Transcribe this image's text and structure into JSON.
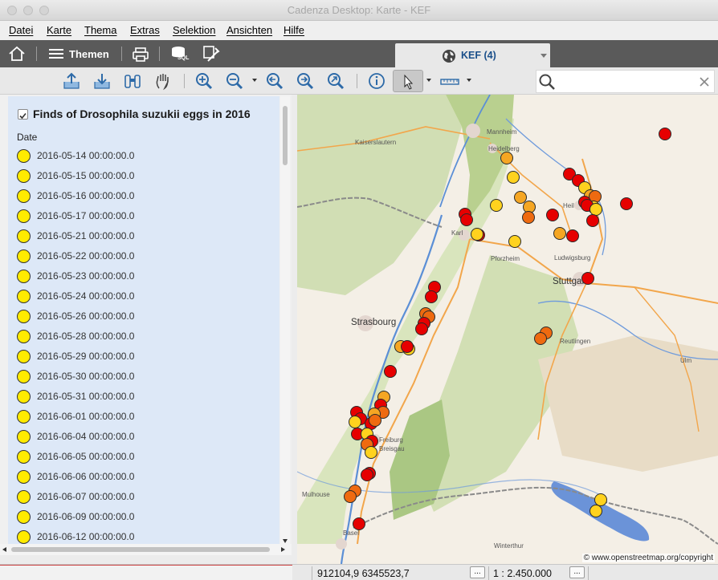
{
  "window": {
    "title": "Cadenza Desktop: Karte - KEF"
  },
  "menu": [
    {
      "label": "Datei"
    },
    {
      "label": "Karte"
    },
    {
      "label": "Thema"
    },
    {
      "label": "Extras"
    },
    {
      "label": "Selektion"
    },
    {
      "label": "Ansichten"
    },
    {
      "label": "Hilfe"
    }
  ],
  "darkbar": {
    "themes_label": "Themen",
    "sql_label": "SQL",
    "tab_label": "KEF (4)"
  },
  "search": {
    "placeholder": "",
    "value": ""
  },
  "legend": {
    "layer_title": "Finds of Drosophila suzukii eggs in 2016",
    "layer_checked": true,
    "attribute_label": "Date",
    "symbol_color": "#ffeb00",
    "items": [
      "2016-05-14 00:00:00.0",
      "2016-05-15 00:00:00.0",
      "2016-05-16 00:00:00.0",
      "2016-05-17 00:00:00.0",
      "2016-05-21 00:00:00.0",
      "2016-05-22 00:00:00.0",
      "2016-05-23 00:00:00.0",
      "2016-05-24 00:00:00.0",
      "2016-05-26 00:00:00.0",
      "2016-05-28 00:00:00.0",
      "2016-05-29 00:00:00.0",
      "2016-05-30 00:00:00.0",
      "2016-05-31 00:00:00.0",
      "2016-06-01 00:00:00.0",
      "2016-06-04 00:00:00.0",
      "2016-06-05 00:00:00.0",
      "2016-06-06 00:00:00.0",
      "2016-06-07 00:00:00.0",
      "2016-06-09 00:00:00.0",
      "2016-06-12 00:00:00.0"
    ]
  },
  "map": {
    "cities": {
      "mannheim": "Mannheim",
      "kaiserslautern": "Kaiserslautern",
      "heidelberg": "Heidelberg",
      "heilbronn": "Heil",
      "karlsruhe": "Karl",
      "pforzheim": "Pforzheim",
      "ludwigsburg": "Ludwigsburg",
      "stuttgart": "Stuttgart",
      "strasbourg": "Strasbourg",
      "reutlingen": "Reutlingen",
      "ulm": "Ulm",
      "freiburg": "Freiburg",
      "breisgau": "Breisgau",
      "mulhouse": "Mulhouse",
      "basel": "Basel",
      "winterthur": "Winterthur"
    },
    "copyright": "© www.openstreetmap.org/copyright",
    "find_colors": {
      "yellow": "#ffd21e",
      "orange": "#f5a623",
      "dark_orange": "#ee6a10",
      "red": "#e60000"
    }
  },
  "status": {
    "coordinates": "912104,9  6345523,7",
    "more_button": "...",
    "scale": "1 : 2.450.000",
    "scale_button": "..."
  }
}
